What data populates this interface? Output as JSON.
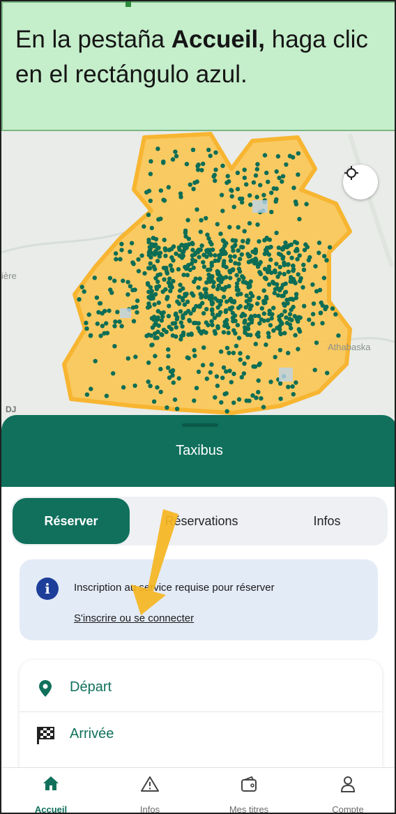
{
  "instruction": {
    "text_before": "En la pestaña ",
    "bold": "Accueil,",
    "text_after": " haga clic en el rectángulo azul."
  },
  "map": {
    "labels": [
      "ière",
      "Athabaska"
    ],
    "attribution": "DJ",
    "zone_color": "#fbc44a",
    "point_color": "#0c6d55",
    "locate_icon": "crosshair-icon"
  },
  "sheet": {
    "title": "Taxibus",
    "tabs": [
      {
        "label": "Réserver",
        "active": true
      },
      {
        "label": "Réservations",
        "active": false
      },
      {
        "label": "Infos",
        "active": false
      }
    ],
    "info": {
      "icon": "info-icon",
      "text": "Inscription au service requise pour réserver",
      "link": "S'inscrire ou se connecter"
    },
    "trip": [
      {
        "label": "Départ",
        "icon": "map-pin-icon"
      },
      {
        "label": "Arrivée",
        "icon": "checkered-flag-icon"
      }
    ]
  },
  "nav": [
    {
      "label": "Accueil",
      "icon": "home-icon",
      "active": true
    },
    {
      "label": "Infos",
      "icon": "warning-icon",
      "active": false
    },
    {
      "label": "Mes titres",
      "icon": "wallet-icon",
      "active": false
    },
    {
      "label": "Compte",
      "icon": "user-icon",
      "active": false
    }
  ],
  "colors": {
    "brand": "#10705c",
    "callout_bg": "#c5eecb",
    "info_bg": "#e3ebf7",
    "arrow": "#f5b51f"
  }
}
